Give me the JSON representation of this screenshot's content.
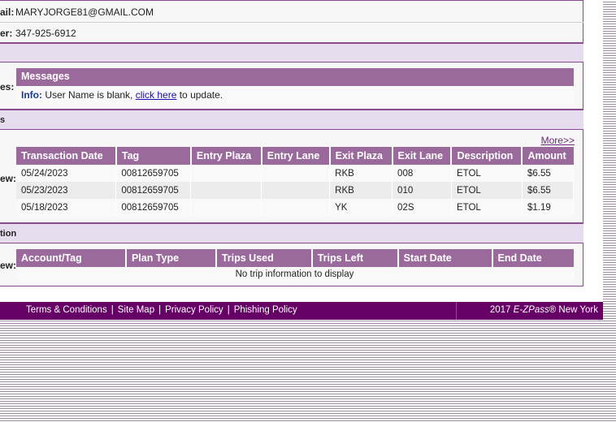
{
  "contact": {
    "email_label": "ail:",
    "email_value": "MARYJORGE81@GMAIL.COM",
    "phone_label": "er:",
    "phone_value": "347-925-6912"
  },
  "messages": {
    "side_label": "es:",
    "header": "Messages",
    "info_label": "Info:",
    "info_text": " User Name is blank, ",
    "link_text": "click here",
    "info_suffix": " to update."
  },
  "transactions": {
    "section_label": "s",
    "side_label": "ew:",
    "more_link": "More>>",
    "columns": [
      "Transaction Date",
      "Tag",
      "Entry Plaza",
      "Entry Lane",
      "Exit Plaza",
      "Exit Lane",
      "Description",
      "Amount"
    ],
    "rows": [
      [
        "05/24/2023",
        "00812659705",
        "",
        "",
        "RKB",
        "008",
        "ETOL",
        "$6.55"
      ],
      [
        "05/23/2023",
        "00812659705",
        "",
        "",
        "RKB",
        "010",
        "ETOL",
        "$6.55"
      ],
      [
        "05/18/2023",
        "00812659705",
        "",
        "",
        "YK",
        "02S",
        "ETOL",
        "$1.19"
      ]
    ]
  },
  "trips": {
    "section_label": "tion",
    "side_label": "ew:",
    "columns": [
      "Account/Tag",
      "Plan Type",
      "Trips Used",
      "Trips Left",
      "Start Date",
      "End Date"
    ],
    "empty_text": "No trip information to display"
  },
  "footer": {
    "links": [
      "Terms & Conditions",
      "Site Map",
      "Privacy Policy",
      "Phishing Policy"
    ],
    "separator": "|",
    "copyright_prefix": "2017 ",
    "copyright_brand": "E-ZPass",
    "copyright_suffix": "® New York"
  }
}
